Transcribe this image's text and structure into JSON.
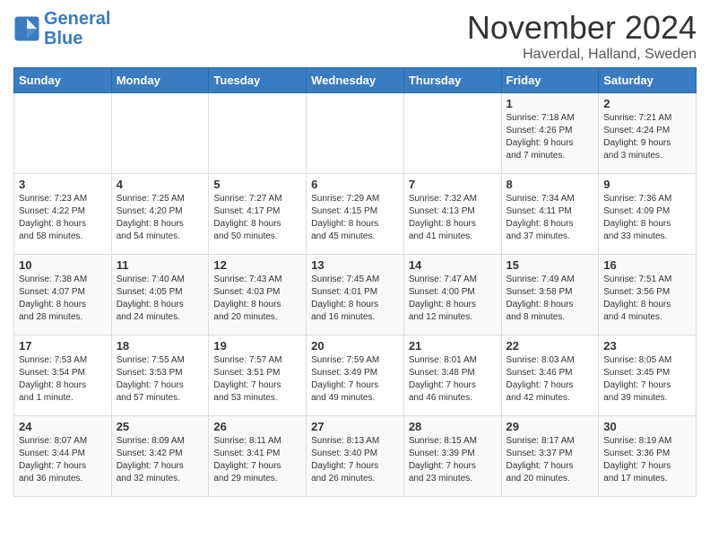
{
  "header": {
    "logo_line1": "General",
    "logo_line2": "Blue",
    "month": "November 2024",
    "location": "Haverdal, Halland, Sweden"
  },
  "columns": [
    "Sunday",
    "Monday",
    "Tuesday",
    "Wednesday",
    "Thursday",
    "Friday",
    "Saturday"
  ],
  "weeks": [
    [
      {
        "day": "",
        "info": ""
      },
      {
        "day": "",
        "info": ""
      },
      {
        "day": "",
        "info": ""
      },
      {
        "day": "",
        "info": ""
      },
      {
        "day": "",
        "info": ""
      },
      {
        "day": "1",
        "info": "Sunrise: 7:18 AM\nSunset: 4:26 PM\nDaylight: 9 hours\nand 7 minutes."
      },
      {
        "day": "2",
        "info": "Sunrise: 7:21 AM\nSunset: 4:24 PM\nDaylight: 9 hours\nand 3 minutes."
      }
    ],
    [
      {
        "day": "3",
        "info": "Sunrise: 7:23 AM\nSunset: 4:22 PM\nDaylight: 8 hours\nand 58 minutes."
      },
      {
        "day": "4",
        "info": "Sunrise: 7:25 AM\nSunset: 4:20 PM\nDaylight: 8 hours\nand 54 minutes."
      },
      {
        "day": "5",
        "info": "Sunrise: 7:27 AM\nSunset: 4:17 PM\nDaylight: 8 hours\nand 50 minutes."
      },
      {
        "day": "6",
        "info": "Sunrise: 7:29 AM\nSunset: 4:15 PM\nDaylight: 8 hours\nand 45 minutes."
      },
      {
        "day": "7",
        "info": "Sunrise: 7:32 AM\nSunset: 4:13 PM\nDaylight: 8 hours\nand 41 minutes."
      },
      {
        "day": "8",
        "info": "Sunrise: 7:34 AM\nSunset: 4:11 PM\nDaylight: 8 hours\nand 37 minutes."
      },
      {
        "day": "9",
        "info": "Sunrise: 7:36 AM\nSunset: 4:09 PM\nDaylight: 8 hours\nand 33 minutes."
      }
    ],
    [
      {
        "day": "10",
        "info": "Sunrise: 7:38 AM\nSunset: 4:07 PM\nDaylight: 8 hours\nand 28 minutes."
      },
      {
        "day": "11",
        "info": "Sunrise: 7:40 AM\nSunset: 4:05 PM\nDaylight: 8 hours\nand 24 minutes."
      },
      {
        "day": "12",
        "info": "Sunrise: 7:43 AM\nSunset: 4:03 PM\nDaylight: 8 hours\nand 20 minutes."
      },
      {
        "day": "13",
        "info": "Sunrise: 7:45 AM\nSunset: 4:01 PM\nDaylight: 8 hours\nand 16 minutes."
      },
      {
        "day": "14",
        "info": "Sunrise: 7:47 AM\nSunset: 4:00 PM\nDaylight: 8 hours\nand 12 minutes."
      },
      {
        "day": "15",
        "info": "Sunrise: 7:49 AM\nSunset: 3:58 PM\nDaylight: 8 hours\nand 8 minutes."
      },
      {
        "day": "16",
        "info": "Sunrise: 7:51 AM\nSunset: 3:56 PM\nDaylight: 8 hours\nand 4 minutes."
      }
    ],
    [
      {
        "day": "17",
        "info": "Sunrise: 7:53 AM\nSunset: 3:54 PM\nDaylight: 8 hours\nand 1 minute."
      },
      {
        "day": "18",
        "info": "Sunrise: 7:55 AM\nSunset: 3:53 PM\nDaylight: 7 hours\nand 57 minutes."
      },
      {
        "day": "19",
        "info": "Sunrise: 7:57 AM\nSunset: 3:51 PM\nDaylight: 7 hours\nand 53 minutes."
      },
      {
        "day": "20",
        "info": "Sunrise: 7:59 AM\nSunset: 3:49 PM\nDaylight: 7 hours\nand 49 minutes."
      },
      {
        "day": "21",
        "info": "Sunrise: 8:01 AM\nSunset: 3:48 PM\nDaylight: 7 hours\nand 46 minutes."
      },
      {
        "day": "22",
        "info": "Sunrise: 8:03 AM\nSunset: 3:46 PM\nDaylight: 7 hours\nand 42 minutes."
      },
      {
        "day": "23",
        "info": "Sunrise: 8:05 AM\nSunset: 3:45 PM\nDaylight: 7 hours\nand 39 minutes."
      }
    ],
    [
      {
        "day": "24",
        "info": "Sunrise: 8:07 AM\nSunset: 3:44 PM\nDaylight: 7 hours\nand 36 minutes."
      },
      {
        "day": "25",
        "info": "Sunrise: 8:09 AM\nSunset: 3:42 PM\nDaylight: 7 hours\nand 32 minutes."
      },
      {
        "day": "26",
        "info": "Sunrise: 8:11 AM\nSunset: 3:41 PM\nDaylight: 7 hours\nand 29 minutes."
      },
      {
        "day": "27",
        "info": "Sunrise: 8:13 AM\nSunset: 3:40 PM\nDaylight: 7 hours\nand 26 minutes."
      },
      {
        "day": "28",
        "info": "Sunrise: 8:15 AM\nSunset: 3:39 PM\nDaylight: 7 hours\nand 23 minutes."
      },
      {
        "day": "29",
        "info": "Sunrise: 8:17 AM\nSunset: 3:37 PM\nDaylight: 7 hours\nand 20 minutes."
      },
      {
        "day": "30",
        "info": "Sunrise: 8:19 AM\nSunset: 3:36 PM\nDaylight: 7 hours\nand 17 minutes."
      }
    ]
  ]
}
